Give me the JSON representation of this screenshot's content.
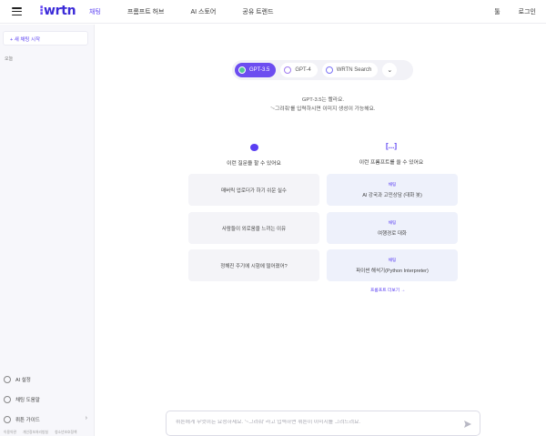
{
  "header": {
    "logo": "wrtn",
    "nav": [
      "채팅",
      "프롬프트 허브",
      "AI 스토어",
      "공유 트렌드"
    ],
    "active_nav": "채팅",
    "right": [
      "툴",
      "로그인"
    ]
  },
  "sidebar": {
    "new_chat": "+ 새 채팅 시작",
    "today_label": "오늘",
    "menu": [
      {
        "label": "AI 설정",
        "icon": "gear-icon"
      },
      {
        "label": "채팅 도움말",
        "icon": "help-icon"
      },
      {
        "label": "뤼튼 가이드",
        "icon": "guide-icon"
      }
    ],
    "footer": [
      "이용약관",
      "개인정보처리방침",
      "청소년보호정책"
    ]
  },
  "models": {
    "options": [
      {
        "label": "GPT-3.5",
        "active": true
      },
      {
        "label": "GPT-4",
        "active": false
      },
      {
        "label": "WRTN Search",
        "active": false
      }
    ]
  },
  "intro": {
    "line1": "GPT-3.5는 빨라요.",
    "line2": "'~그려줘'를 입력하시면 이미지 생성이 가능해요."
  },
  "left_column": {
    "title": "이런 질문을 할 수 있어요",
    "cards": [
      "매버릭 업로더가 하기 쉬운 실수",
      "사람들이 외로움을 느끼는 이유",
      "정해진 주기에 시험에 떨어졌어?"
    ]
  },
  "right_column": {
    "title": "이런 프롬프트를 쓸 수 있어요",
    "cards": [
      {
        "tag": "채팅",
        "label": "AI 강국과 고민상담 (대화 봇)"
      },
      {
        "tag": "채팅",
        "label": "여행경로 대화"
      },
      {
        "tag": "채팅",
        "label": "파이썬 해석기(Python Interpreter)"
      }
    ],
    "more_link": "프롬프트 더보기 →"
  },
  "chat_input": {
    "placeholder": "뤼튼에게 무엇이든 요청하세요. '~그려줘' 라고 입력하면 뤼튼이 이미지를 그려드려요."
  },
  "colors": {
    "accent": "#5a3ff2",
    "model_active": "#6c4df0"
  }
}
